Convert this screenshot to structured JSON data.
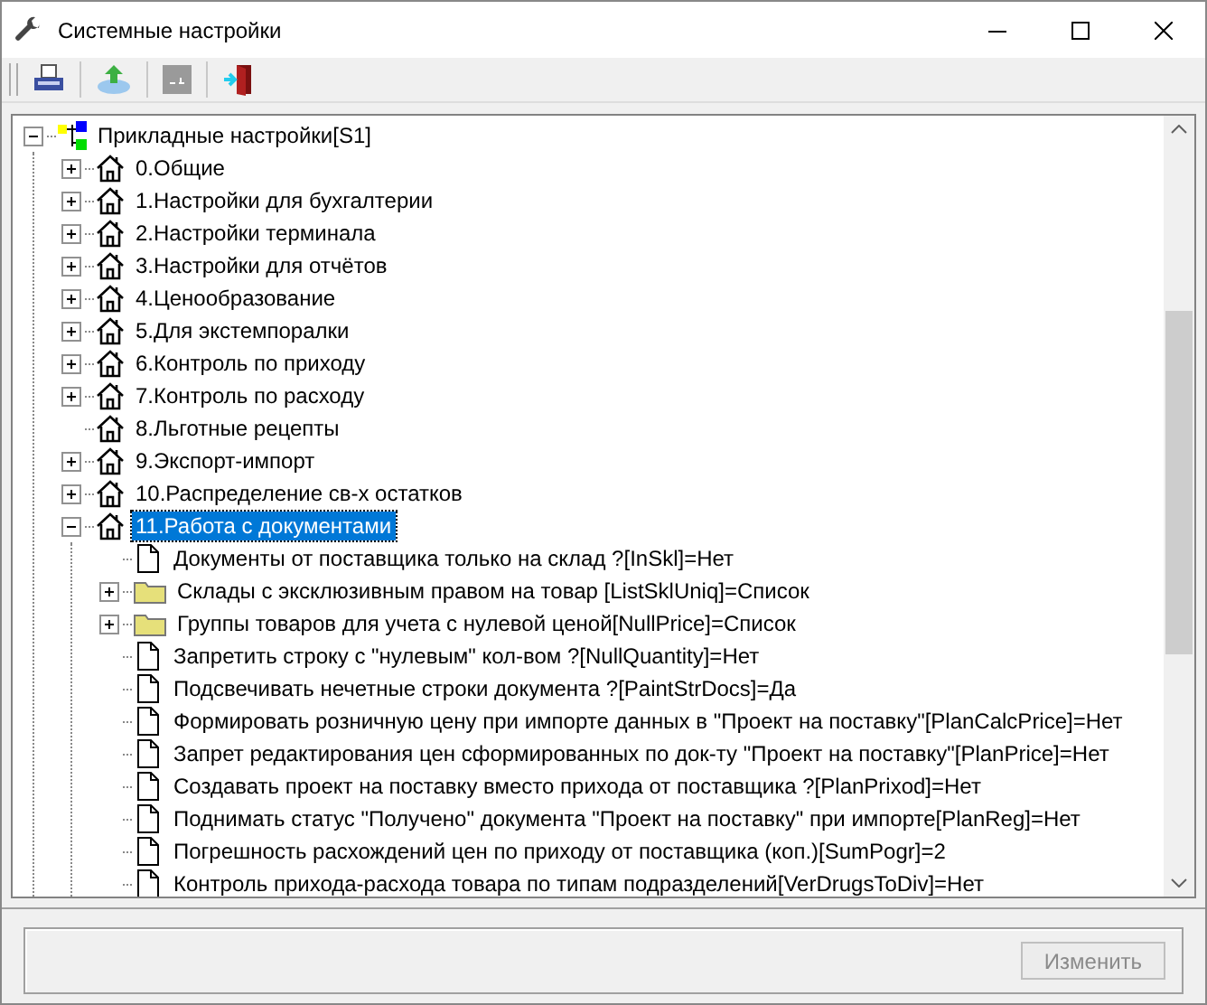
{
  "window": {
    "title": "Системные настройки"
  },
  "toolbar": [
    {
      "kind": "print"
    },
    {
      "kind": "import"
    },
    {
      "kind": "blank"
    },
    {
      "kind": "exit"
    }
  ],
  "tree": {
    "label": "Прикладные настройки[S1]",
    "kind": "root",
    "expanded": true,
    "selected": false,
    "children": [
      {
        "label": "0.Общие",
        "kind": "house",
        "expanded": false,
        "selected": false
      },
      {
        "label": "1.Настройки для бухгалтерии",
        "kind": "house",
        "expanded": false,
        "selected": false
      },
      {
        "label": "2.Настройки терминала",
        "kind": "house",
        "expanded": false,
        "selected": false
      },
      {
        "label": "3.Настройки для отчётов",
        "kind": "house",
        "expanded": false,
        "selected": false
      },
      {
        "label": "4.Ценообразование",
        "kind": "house",
        "expanded": false,
        "selected": false
      },
      {
        "label": "5.Для экстемпоралки",
        "kind": "house",
        "expanded": false,
        "selected": false
      },
      {
        "label": "6.Контроль по приходу",
        "kind": "house",
        "expanded": false,
        "selected": false
      },
      {
        "label": "7.Контроль по расходу",
        "kind": "house",
        "expanded": false,
        "selected": false
      },
      {
        "label": "8.Льготные рецепты",
        "kind": "house",
        "selected": false
      },
      {
        "label": "9.Экспорт-импорт",
        "kind": "house",
        "expanded": false,
        "selected": false
      },
      {
        "label": "10.Распределение св-х остатков",
        "kind": "house",
        "expanded": false,
        "selected": false
      },
      {
        "label": "11.Работа с документами",
        "kind": "house",
        "expanded": true,
        "selected": true,
        "children": [
          {
            "label": "Документы от поставщика только на склад ?[InSkl]=Нет",
            "kind": "doc",
            "selected": false
          },
          {
            "label": "Склады с эксклюзивным правом на товар [ListSklUniq]=Список",
            "kind": "folder",
            "expanded": false,
            "selected": false
          },
          {
            "label": "Группы товаров для учета с нулевой ценой[NullPrice]=Список",
            "kind": "folder",
            "expanded": false,
            "selected": false
          },
          {
            "label": "Запретить строку с \"нулевым\" кол-вом ?[NullQuantity]=Нет",
            "kind": "doc",
            "selected": false
          },
          {
            "label": "Подсвечивать нечетные строки документа ?[PaintStrDocs]=Да",
            "kind": "doc",
            "selected": false
          },
          {
            "label": "Формировать розничную цену при импорте данных в \"Проект на поставку\"[PlanCalcPrice]=Нет",
            "kind": "doc",
            "selected": false
          },
          {
            "label": "Запрет редактирования цен сформированных по док-ту \"Проект на поставку\"[PlanPrice]=Нет",
            "kind": "doc",
            "selected": false
          },
          {
            "label": "Создавать проект на поставку вместо прихода от поставщика ?[PlanPrixod]=Нет",
            "kind": "doc",
            "selected": false
          },
          {
            "label": "Поднимать статус \"Получено\"  документа \"Проект на поставку\" при импорте[PlanReg]=Нет",
            "kind": "doc",
            "selected": false
          },
          {
            "label": "Погрешность расхождений цен по приходу от поставщика (коп.)[SumPogr]=2",
            "kind": "doc",
            "selected": false
          },
          {
            "label": "Контроль прихода-расхода товара по типам подразделений[VerDrugsToDiv]=Нет",
            "kind": "doc",
            "selected": false
          }
        ]
      }
    ]
  },
  "edit_button": {
    "label": "Изменить",
    "disabled": true
  }
}
